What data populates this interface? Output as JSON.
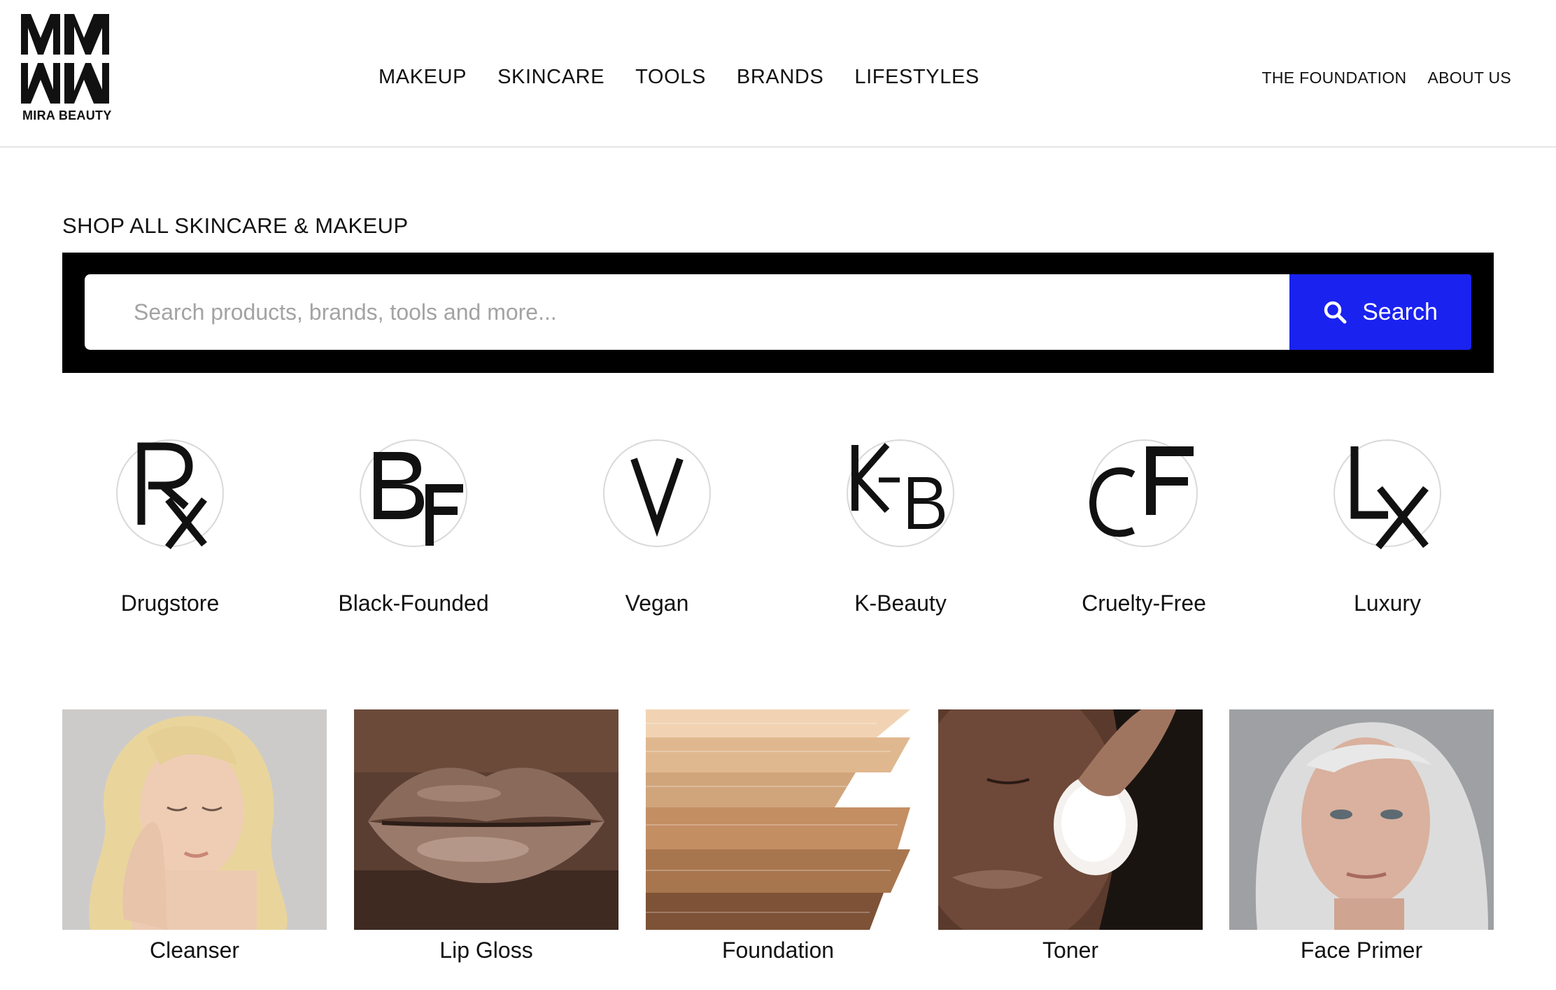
{
  "brand": {
    "logo_text": "MIRA BEAUTY",
    "logo_letters": "MM"
  },
  "nav": {
    "main": [
      "MAKEUP",
      "SKINCARE",
      "TOOLS",
      "BRANDS",
      "LIFESTYLES"
    ],
    "utility": [
      "THE FOUNDATION",
      "ABOUT US"
    ]
  },
  "search": {
    "heading": "SHOP ALL SKINCARE & MAKEUP",
    "placeholder": "Search products, brands, tools and more...",
    "button_label": "Search",
    "button_icon": "search-icon"
  },
  "lifestyles": [
    {
      "monogram": "RX",
      "label": "Drugstore"
    },
    {
      "monogram": "BF",
      "label": "Black-Founded"
    },
    {
      "monogram": "V",
      "label": "Vegan"
    },
    {
      "monogram": "KB",
      "label": "K-Beauty"
    },
    {
      "monogram": "CF",
      "label": "Cruelty-Free"
    },
    {
      "monogram": "LX",
      "label": "Luxury"
    }
  ],
  "categories": [
    {
      "label": "Cleanser",
      "image": "cleanser-photo"
    },
    {
      "label": "Lip Gloss",
      "image": "lip-gloss-photo"
    },
    {
      "label": "Foundation",
      "image": "foundation-swatches-photo"
    },
    {
      "label": "Toner",
      "image": "toner-photo"
    },
    {
      "label": "Face Primer",
      "image": "face-primer-photo"
    }
  ],
  "colors": {
    "accent": "#1a22f0",
    "search_frame": "#000000",
    "text": "#111111",
    "placeholder": "#a3a3a3",
    "divider": "#e6e6e6"
  }
}
